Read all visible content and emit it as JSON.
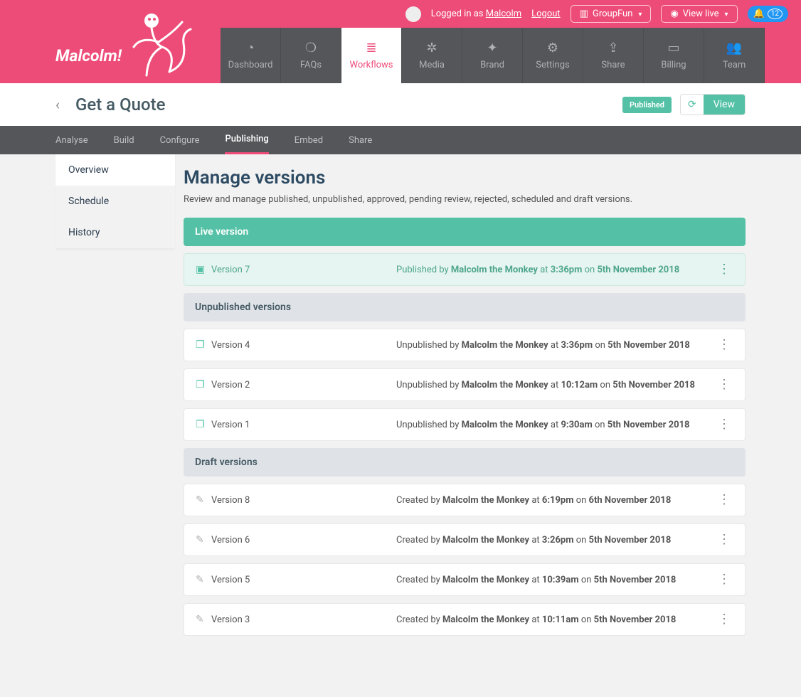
{
  "topbar": {
    "logged_prefix": "Logged in as ",
    "username": "Malcolm",
    "logout": "Logout",
    "org_label": "GroupFun",
    "view_live": "View live",
    "notif_count": "12"
  },
  "brand": {
    "name": "Malcolm!"
  },
  "nav": {
    "items": [
      {
        "label": "Dashboard",
        "icon": "◔"
      },
      {
        "label": "FAQs",
        "icon": "❍"
      },
      {
        "label": "Workflows",
        "icon": "≣",
        "active": true
      },
      {
        "label": "Media",
        "icon": "✲"
      },
      {
        "label": "Brand",
        "icon": "✦"
      },
      {
        "label": "Settings",
        "icon": "⚙"
      },
      {
        "label": "Share",
        "icon": "⇪"
      },
      {
        "label": "Billing",
        "icon": "▭"
      },
      {
        "label": "Team",
        "icon": "👥"
      }
    ]
  },
  "title": {
    "page": "Get a Quote",
    "published_badge": "Published",
    "view_label": "View"
  },
  "subtabs": {
    "items": [
      {
        "label": "Analyse"
      },
      {
        "label": "Build"
      },
      {
        "label": "Configure"
      },
      {
        "label": "Publishing",
        "active": true
      },
      {
        "label": "Embed"
      },
      {
        "label": "Share"
      }
    ]
  },
  "sidebar": {
    "items": [
      {
        "label": "Overview",
        "active": true
      },
      {
        "label": "Schedule"
      },
      {
        "label": "History"
      }
    ]
  },
  "main": {
    "heading": "Manage versions",
    "desc": "Review and manage published, unpublished, approved, pending review, rejected, scheduled and draft versions.",
    "live_header": "Live version",
    "unpub_header": "Unpublished versions",
    "draft_header": "Draft versions",
    "live": {
      "name": "Version 7",
      "prefix": "Published by ",
      "author": "Malcolm the Monkey",
      "at": " at ",
      "time": "3:36pm",
      "on": " on ",
      "date": "5th November 2018"
    },
    "unpublished": [
      {
        "name": "Version 4",
        "prefix": "Unpublished by ",
        "author": "Malcolm the Monkey",
        "at": " at ",
        "time": "3:36pm",
        "on": " on ",
        "date": "5th November 2018"
      },
      {
        "name": "Version 2",
        "prefix": "Unpublished by ",
        "author": "Malcolm the Monkey",
        "at": " at ",
        "time": "10:12am",
        "on": " on ",
        "date": "5th November 2018"
      },
      {
        "name": "Version 1",
        "prefix": "Unpublished by ",
        "author": "Malcolm the Monkey",
        "at": " at ",
        "time": "9:30am",
        "on": " on ",
        "date": "5th November 2018"
      }
    ],
    "drafts": [
      {
        "name": "Version 8",
        "prefix": "Created by ",
        "author": "Malcolm the Monkey",
        "at": " at ",
        "time": "6:19pm",
        "on": " on ",
        "date": "6th November 2018"
      },
      {
        "name": "Version 6",
        "prefix": "Created by ",
        "author": "Malcolm the Monkey",
        "at": " at ",
        "time": "3:26pm",
        "on": " on ",
        "date": "5th November 2018"
      },
      {
        "name": "Version 5",
        "prefix": "Created by ",
        "author": "Malcolm the Monkey",
        "at": " at ",
        "time": "10:39am",
        "on": " on ",
        "date": "5th November 2018"
      },
      {
        "name": "Version 3",
        "prefix": "Created by ",
        "author": "Malcolm the Monkey",
        "at": " at ",
        "time": "10:11am",
        "on": " on ",
        "date": "5th November 2018"
      }
    ]
  }
}
